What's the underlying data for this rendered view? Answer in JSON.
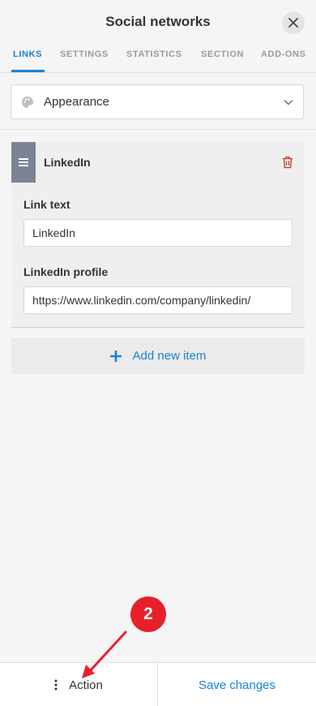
{
  "header": {
    "title": "Social networks",
    "close_icon": "close-icon"
  },
  "tabs": [
    {
      "label": "LINKS",
      "active": true
    },
    {
      "label": "SETTINGS",
      "active": false
    },
    {
      "label": "STATISTICS",
      "active": false
    },
    {
      "label": "SECTION",
      "active": false
    },
    {
      "label": "ADD-ONS",
      "active": false
    }
  ],
  "appearance": {
    "label": "Appearance",
    "icon": "palette-icon"
  },
  "item": {
    "name": "LinkedIn",
    "fields": [
      {
        "label": "Link text",
        "value": "LinkedIn"
      },
      {
        "label": "LinkedIn profile",
        "value": "https://www.linkedin.com/company/linkedin/"
      }
    ]
  },
  "add_item": {
    "label": "Add new item"
  },
  "footer": {
    "action_label": "Action",
    "save_label": "Save changes"
  },
  "annotation": {
    "step_number": "2"
  },
  "colors": {
    "accent": "#1a82d6",
    "handle": "#7b8494",
    "delete": "#c0392b",
    "badge": "#e8202a"
  }
}
